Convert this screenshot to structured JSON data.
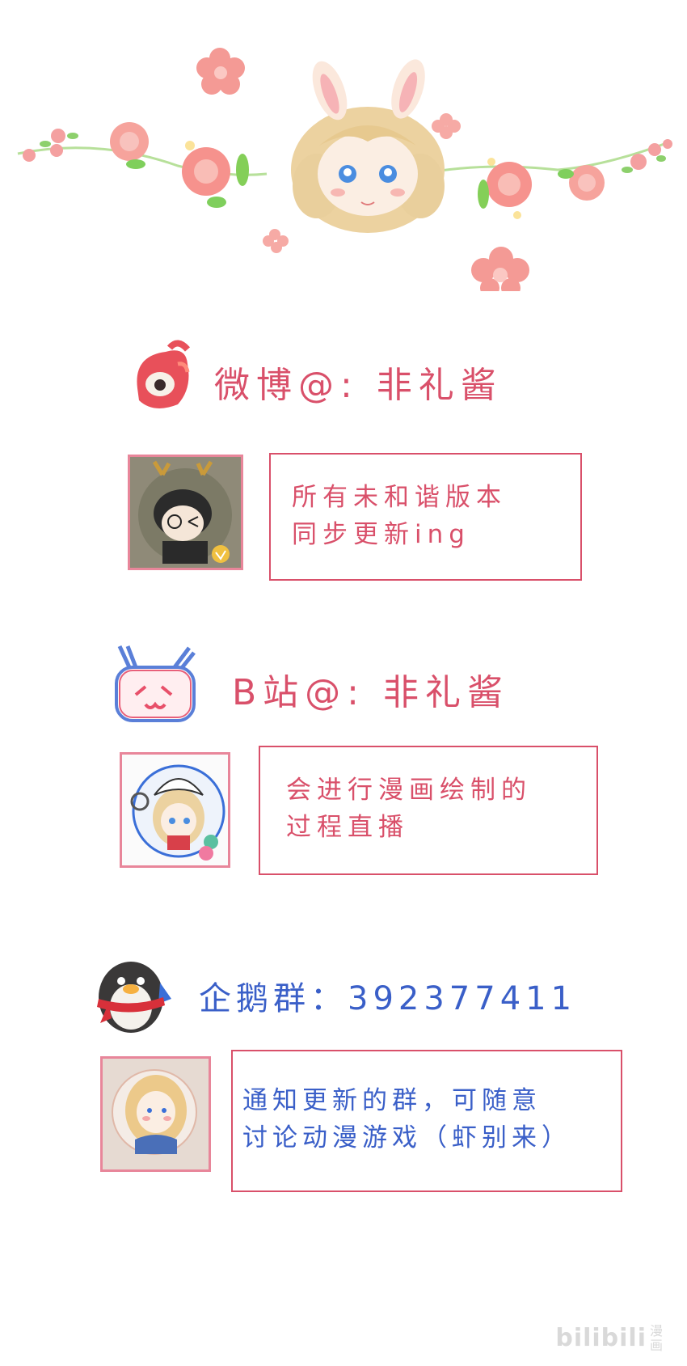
{
  "colors": {
    "accent_red": "#d9506a",
    "accent_blue": "#3a5fc8",
    "box_border": "#d9506a",
    "flower_pink": "#f58f8a",
    "leaf_green": "#7ccf5a",
    "hair_blonde": "#ecd2a0"
  },
  "sections": {
    "weibo": {
      "icon": "weibo-icon",
      "handle": "微博@: 非礼酱",
      "lines": [
        "所有未和谐版本",
        "同步更新ing"
      ]
    },
    "bilibili": {
      "icon": "bilibili-tv-icon",
      "handle": "B站@: 非礼酱",
      "lines": [
        "会进行漫画绘制的",
        "过程直播"
      ]
    },
    "qq": {
      "icon": "penguin-icon",
      "handle": "企鹅群：392377411",
      "lines": [
        "通知更新的群，可随意",
        "讨论动漫游戏（虾别来）"
      ]
    }
  },
  "watermark": {
    "logo": "bilibili",
    "sub": "漫画"
  }
}
